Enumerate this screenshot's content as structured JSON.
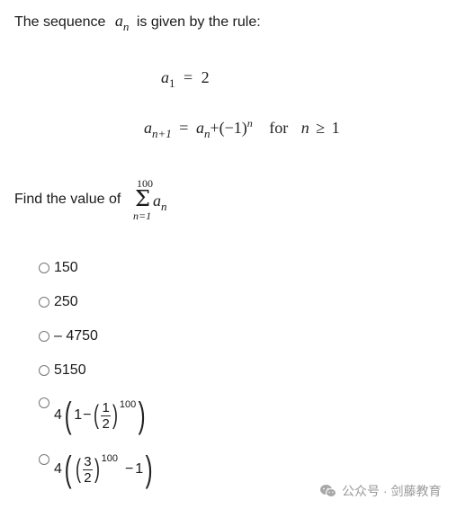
{
  "intro": {
    "before": "The sequence",
    "var": "a",
    "var_sub": "n",
    "after": "is given by the rule:"
  },
  "rule1": {
    "lhs_var": "a",
    "lhs_sub": "1",
    "eq": "=",
    "rhs": "2"
  },
  "rule2": {
    "lhs_var": "a",
    "lhs_sub": "n+1",
    "eq": "=",
    "rhs_var": "a",
    "rhs_sub": "n",
    "plus": "+",
    "paren": "(−1)",
    "exp": "n",
    "for": "for",
    "cond_var": "n",
    "cond_op": "≥",
    "cond_val": "1"
  },
  "question": {
    "text": "Find the value of",
    "sigma": "Σ",
    "upper": "100",
    "lower": "n=1",
    "term_var": "a",
    "term_sub": "n"
  },
  "options": [
    {
      "label": "150",
      "selected": false
    },
    {
      "label": "250",
      "selected": false
    },
    {
      "label": "– 4750",
      "selected": false
    },
    {
      "label": "5150",
      "selected": false
    },
    {
      "label": "4(1−(1/2)^100)",
      "coef": "4",
      "one": "1",
      "minus": "−",
      "num": "1",
      "den": "2",
      "exp": "100",
      "selected": false
    },
    {
      "label": "4((3/2)^100−1)",
      "coef": "4",
      "num": "3",
      "den": "2",
      "exp": "100",
      "minus": "−",
      "one": "1",
      "selected": false
    }
  ],
  "watermark": {
    "icon": "wechat-icon",
    "text": "公众号 · 剑藤教育"
  }
}
